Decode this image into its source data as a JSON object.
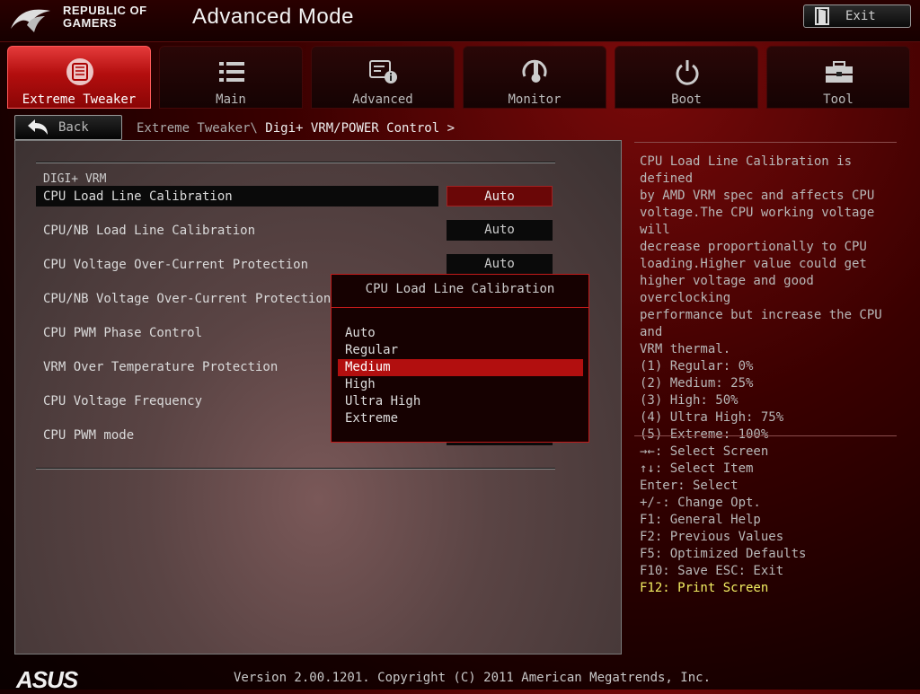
{
  "header": {
    "logo_lines": [
      "REPUBLIC OF",
      "GAMERS"
    ],
    "title": "Advanced Mode",
    "exit_label": "Exit"
  },
  "tabs": [
    {
      "label": "Extreme Tweaker",
      "icon": "fan-icon",
      "active": true
    },
    {
      "label": "Main",
      "icon": "list-icon",
      "active": false
    },
    {
      "label": "Advanced",
      "icon": "chip-info-icon",
      "active": false
    },
    {
      "label": "Monitor",
      "icon": "thermometer-gauge-icon",
      "active": false
    },
    {
      "label": "Boot",
      "icon": "power-icon",
      "active": false
    },
    {
      "label": "Tool",
      "icon": "toolbox-icon",
      "active": false
    }
  ],
  "nav": {
    "back_label": "Back",
    "breadcrumb_parent": "Extreme Tweaker\\",
    "breadcrumb_current": "Digi+ VRM/POWER Control >"
  },
  "section": {
    "title": "DIGI+ VRM",
    "rows": [
      {
        "label": "CPU Load Line Calibration",
        "value": "Auto",
        "selected": true
      },
      {
        "label": "CPU/NB Load Line Calibration",
        "value": "Auto"
      },
      {
        "label": "CPU Voltage Over-Current Protection",
        "value": "Auto"
      },
      {
        "label": "CPU/NB Voltage Over-Current Protection",
        "value": ""
      },
      {
        "label": "CPU PWM Phase Control",
        "value": ""
      },
      {
        "label": "VRM Over Temperature Protection",
        "value": ""
      },
      {
        "label": "CPU Voltage Frequency",
        "value": ""
      },
      {
        "label": "CPU PWM mode",
        "value": ""
      }
    ]
  },
  "popup": {
    "title": "CPU Load Line Calibration",
    "options": [
      "Auto",
      "Regular",
      "Medium",
      "High",
      "Ultra High",
      "Extreme"
    ],
    "highlighted": "Medium"
  },
  "help": {
    "lines": [
      "CPU Load Line Calibration is defined",
      "by AMD VRM spec and affects CPU",
      "voltage.The CPU working voltage will",
      "decrease proportionally to CPU",
      "loading.Higher value could get",
      "higher voltage and good overclocking",
      "performance but increase the CPU and",
      "VRM thermal.",
      "(1) Regular: 0%",
      "(2) Medium: 25%",
      "(3) High: 50%",
      "(4) Ultra High: 75%",
      "(5) Extreme: 100%"
    ]
  },
  "keys": [
    "→←: Select Screen",
    "↑↓: Select Item",
    "Enter: Select",
    "+/-: Change Opt.",
    "F1: General Help",
    "F2: Previous Values",
    "F5: Optimized Defaults",
    "F10: Save  ESC: Exit",
    "F12: Print Screen"
  ],
  "footer": {
    "brand": "ASUS",
    "version": "Version 2.00.1201. Copyright (C) 2011 American Megatrends, Inc."
  },
  "colors": {
    "accent_red": "#b20f0f",
    "highlight_yellow": "#f3ef62"
  }
}
